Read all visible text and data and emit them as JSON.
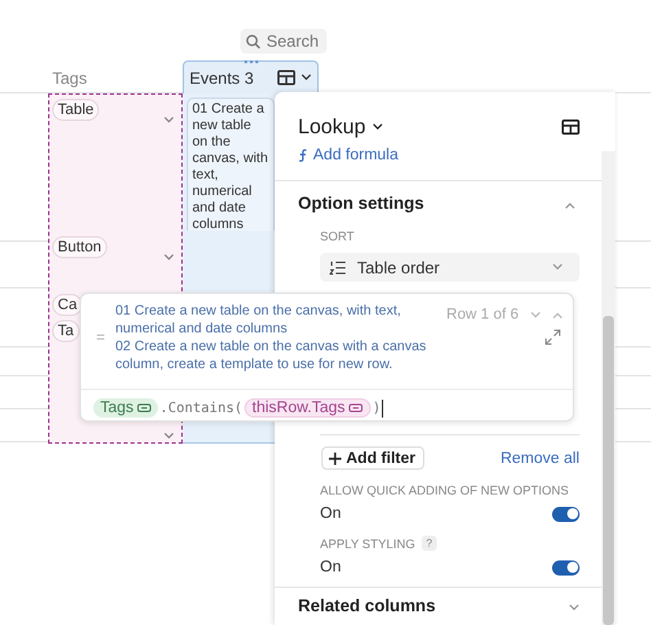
{
  "search": {
    "label": "Search"
  },
  "table": {
    "columns": [
      {
        "label": "Tags",
        "selected": false
      },
      {
        "label": "Events 3",
        "selected": true
      }
    ],
    "rows": [
      {
        "tags": [
          "Table"
        ],
        "event": "01 Create a new table on the canvas, with text, numerical and date columns"
      },
      {
        "tags": [
          "Button"
        ]
      },
      {
        "tags": [
          "Ca",
          "Ta"
        ]
      }
    ]
  },
  "panel": {
    "title": "Lookup",
    "add_formula": "Add formula",
    "section": {
      "title": "Option settings",
      "expanded": true
    },
    "sort": {
      "label": "SORT",
      "value": "Table order"
    },
    "add_filter": "Add filter",
    "remove_all": "Remove all",
    "options": [
      {
        "label": "ALLOW QUICK ADDING OF NEW OPTIONS",
        "value": "On",
        "on": true
      },
      {
        "label": "APPLY STYLING",
        "help": "?",
        "value": "On",
        "on": true
      }
    ],
    "related": {
      "title": "Related columns",
      "expanded": false
    }
  },
  "popup": {
    "equals": "=",
    "results": [
      "01 Create a new table on the canvas, with text, numerical and date columns",
      "02 Create a new table on the canvas with a canvas column, create a template to use for new row."
    ],
    "row_counter": "Row 1 of 6",
    "formula": [
      {
        "kind": "column",
        "text": "Tags"
      },
      {
        "kind": "code",
        "text": ".Contains("
      },
      {
        "kind": "ref",
        "text": "thisRow.Tags"
      },
      {
        "kind": "code",
        "text": ")"
      }
    ]
  }
}
